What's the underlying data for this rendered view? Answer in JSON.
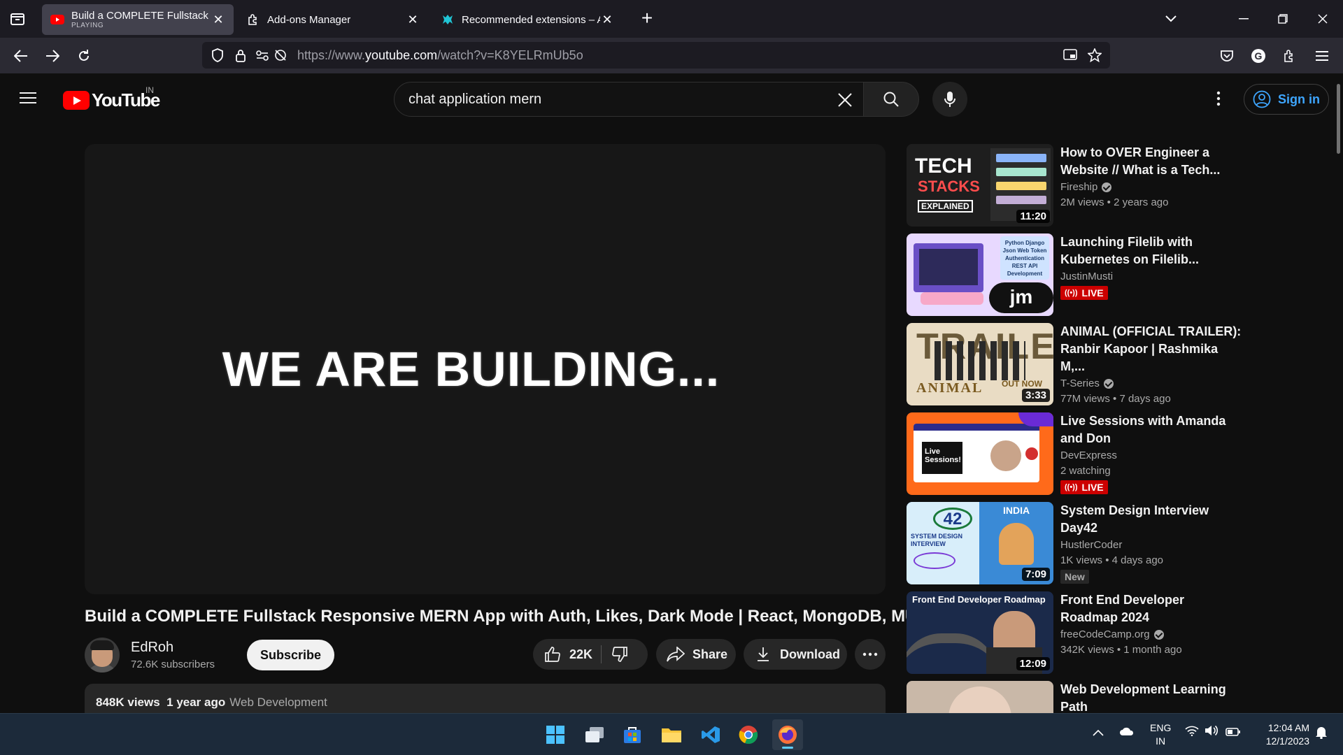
{
  "browser": {
    "tabs": [
      {
        "title": "Build a COMPLETE Fullstack Responsive MERN App with Auth",
        "status": "PLAYING",
        "active": true
      },
      {
        "title": "Add-ons Manager",
        "active": false
      },
      {
        "title": "Recommended extensions – Add-ons for Firefox",
        "active": false
      }
    ],
    "url_prefix": "https://www.",
    "url_domain": "youtube.com",
    "url_path": "/watch?v=K8YELRmUb5o"
  },
  "youtube": {
    "logo_text": "YouTube",
    "country_code": "IN",
    "search_query": "chat application mern",
    "sign_in_label": "Sign in"
  },
  "player": {
    "overlay_text": "WE ARE BUILDING..."
  },
  "video": {
    "title": "Build a COMPLETE Fullstack Responsive MERN App with Auth, Likes, Dark Mode | React, MongoDB, MUI",
    "channel": "EdRoh",
    "subscribers": "72.6K subscribers",
    "subscribe_label": "Subscribe",
    "likes": "22K",
    "share_label": "Share",
    "download_label": "Download",
    "views": "848K views",
    "age": "1 year ago",
    "category": "Web Development"
  },
  "related": [
    {
      "title": "How to OVER Engineer a Website // What is a Tech...",
      "channel": "Fireship",
      "verified": true,
      "stats": "2M views  • 2 years ago",
      "duration": "11:20",
      "thumb_text": "TECH STACKS EXPLAINED"
    },
    {
      "title": "Launching Filelib with Kubernetes on Filelib...",
      "channel": "JustinMusti",
      "verified": false,
      "live": "LIVE",
      "thumb_text": "Python Django Json Web Token Authentication REST API Development"
    },
    {
      "title": "ANIMAL (OFFICIAL TRAILER): Ranbir Kapoor | Rashmika M,...",
      "channel": "T-Series",
      "verified": true,
      "stats": "77M views  • 7 days ago",
      "duration": "3:33",
      "thumb_text": "TRAILER ANIMAL OUT NOW"
    },
    {
      "title": "Live Sessions with Amanda and Don",
      "channel": "DevExpress",
      "verified": false,
      "stats": "2 watching",
      "live": "LIVE",
      "thumb_text": "Live Sessions!"
    },
    {
      "title": "System Design Interview Day42",
      "channel": "HustlerCoder",
      "verified": false,
      "stats": "1K views  • 4 days ago",
      "badge": "New",
      "duration": "7:09",
      "thumb_text": "DAY 42 SYSTEM DESIGN INTERVIEW INDIA"
    },
    {
      "title": "Front End Developer Roadmap 2024",
      "channel": "freeCodeCamp.org",
      "verified": true,
      "stats": "342K views  • 1 month ago",
      "duration": "12:09",
      "thumb_text": "Front End Developer Roadmap"
    },
    {
      "title": "Web Development Learning Path",
      "channel": "",
      "verified": false
    }
  ],
  "taskbar": {
    "lang_top": "ENG",
    "lang_bottom": "IN",
    "time": "12:04 AM",
    "date": "12/1/2023"
  },
  "colors": {
    "yt_red": "#ff0000",
    "link_blue": "#3ea6ff",
    "live_red": "#cc0000"
  }
}
